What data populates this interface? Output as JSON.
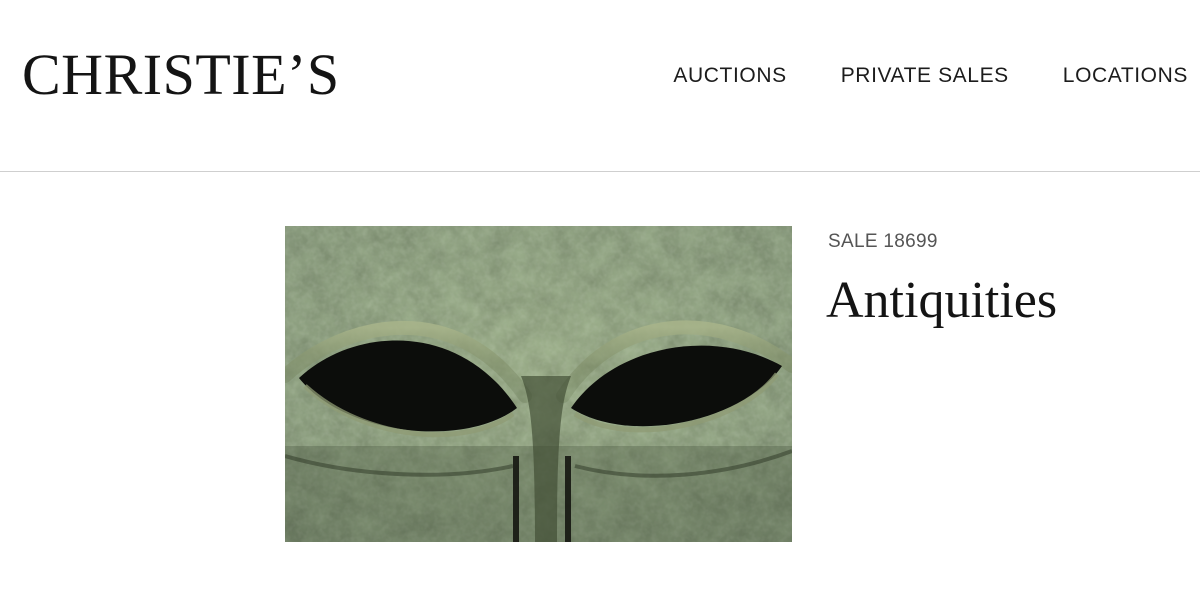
{
  "header": {
    "logo_text": "CHRISTIE’S",
    "nav": [
      {
        "label": "AUCTIONS"
      },
      {
        "label": "PRIVATE SALES"
      },
      {
        "label": "LOCATIONS"
      }
    ]
  },
  "sale": {
    "number_label": "SALE 18699",
    "title": "Antiquities",
    "image": {
      "subject": "bronze-helmet-eyes"
    }
  },
  "colors": {
    "background": "#ffffff",
    "divider": "#cfcfcf",
    "text": "#141414",
    "muted_text": "#555555",
    "bronze_patina": "#5d6f4a"
  }
}
